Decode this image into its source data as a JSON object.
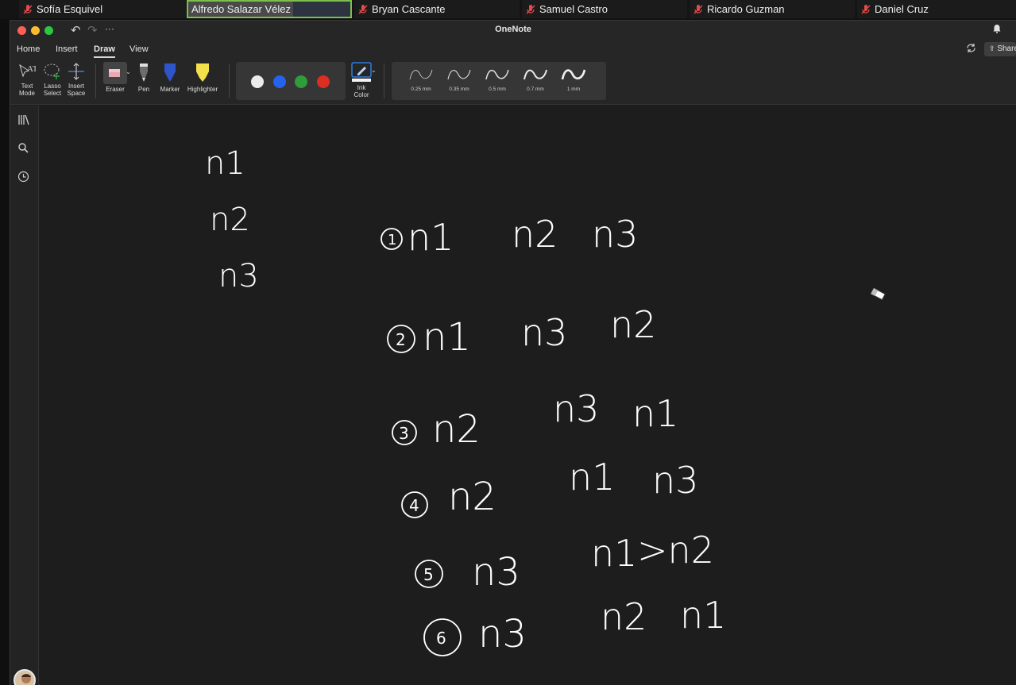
{
  "participants": [
    {
      "name": "Sofía Esquivel",
      "muted": true
    },
    {
      "name": "Alfredo Salazar Vélez",
      "muted": false,
      "active": true
    },
    {
      "name": "Bryan Cascante",
      "muted": true
    },
    {
      "name": "Samuel Castro",
      "muted": true
    },
    {
      "name": "Ricardo Guzman",
      "muted": true
    },
    {
      "name": "Daniel Cruz",
      "muted": true
    }
  ],
  "window": {
    "title": "OneNote",
    "more_label": "···"
  },
  "menu": {
    "tabs": [
      "Home",
      "Insert",
      "Draw",
      "View"
    ],
    "active": "Draw",
    "share_label": "Share"
  },
  "ribbon": {
    "text_mode": "Text\nMode",
    "lasso_select": "Lasso\nSelect",
    "insert_space": "Insert\nSpace",
    "eraser": "Eraser",
    "pen": "Pen",
    "marker": "Marker",
    "highlighter": "Highlighter",
    "ink_color": "Ink\nColor",
    "colors": [
      "#ececec",
      "#2563eb",
      "#2e9d3a",
      "#dc2f24"
    ],
    "strokes": [
      "0.25 mm",
      "0.35 mm",
      "0.5 mm",
      "0.7 mm",
      "1 mm"
    ]
  },
  "canvas": {
    "ink_color": "#ffffff",
    "list": [
      "n1",
      "n2",
      "n3"
    ],
    "rows": [
      {
        "num": "1",
        "a": "n1",
        "b": "n2",
        "c": "n3"
      },
      {
        "num": "2",
        "a": "n1",
        "b": "n3",
        "c": "n2"
      },
      {
        "num": "3",
        "a": "n2",
        "b": "n3",
        "c": "n1"
      },
      {
        "num": "4",
        "a": "n2",
        "b": "n1",
        "c": "n3"
      },
      {
        "num": "5",
        "a": "n3",
        "b": "n1",
        "c": ">n2"
      },
      {
        "num": "6",
        "a": "n3",
        "b": "n2",
        "c": "n1"
      }
    ]
  }
}
